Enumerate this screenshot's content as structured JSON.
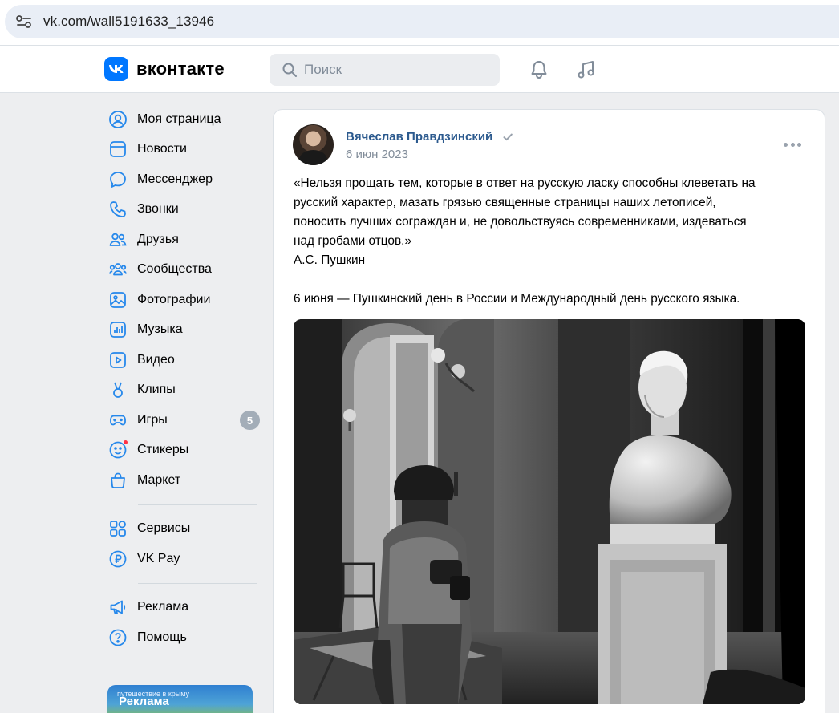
{
  "browser": {
    "url": "vk.com/wall5191633_13946"
  },
  "header": {
    "logo_text": "вконтакте",
    "search_placeholder": "Поиск"
  },
  "nav": {
    "items": [
      {
        "label": "Моя страница",
        "icon": "profile-icon"
      },
      {
        "label": "Новости",
        "icon": "news-icon"
      },
      {
        "label": "Мессенджер",
        "icon": "messenger-icon"
      },
      {
        "label": "Звонки",
        "icon": "phone-icon"
      },
      {
        "label": "Друзья",
        "icon": "friends-icon"
      },
      {
        "label": "Сообщества",
        "icon": "communities-icon"
      },
      {
        "label": "Фотографии",
        "icon": "photos-icon"
      },
      {
        "label": "Музыка",
        "icon": "music-icon"
      },
      {
        "label": "Видео",
        "icon": "video-icon"
      },
      {
        "label": "Клипы",
        "icon": "clips-icon"
      },
      {
        "label": "Игры",
        "icon": "games-icon",
        "badge": "5"
      },
      {
        "label": "Стикеры",
        "icon": "stickers-icon"
      },
      {
        "label": "Маркет",
        "icon": "market-icon"
      }
    ],
    "secondary": [
      {
        "label": "Сервисы",
        "icon": "services-icon"
      },
      {
        "label": "VK Pay",
        "icon": "vkpay-icon"
      }
    ],
    "tertiary": [
      {
        "label": "Реклама",
        "icon": "ads-icon"
      },
      {
        "label": "Помощь",
        "icon": "help-icon"
      }
    ],
    "ad_banner_label": "Реклама",
    "ad_banner_caption": "путешествие в крыму"
  },
  "post": {
    "author": "Вячеслав Правдзинский",
    "date": "6 июн 2023",
    "text_lines": [
      "«Нельзя прощать тем, которые в ответ на русскую ласку способны клеветать на",
      "русский характер, мазать грязью священные страницы наших летописей,",
      "поносить лучших сограждан и, не довольствуясь современниками, издеваться",
      "над гробами отцов.»",
      "А.С. Пушкин"
    ],
    "text_footer": "6 июня — Пушкинский день в России и Международный день русского языка."
  },
  "colors": {
    "brand": "#0077ff",
    "author_link": "#2c5a8e",
    "secondary_text": "#818c99",
    "page_bg": "#edeef0"
  }
}
